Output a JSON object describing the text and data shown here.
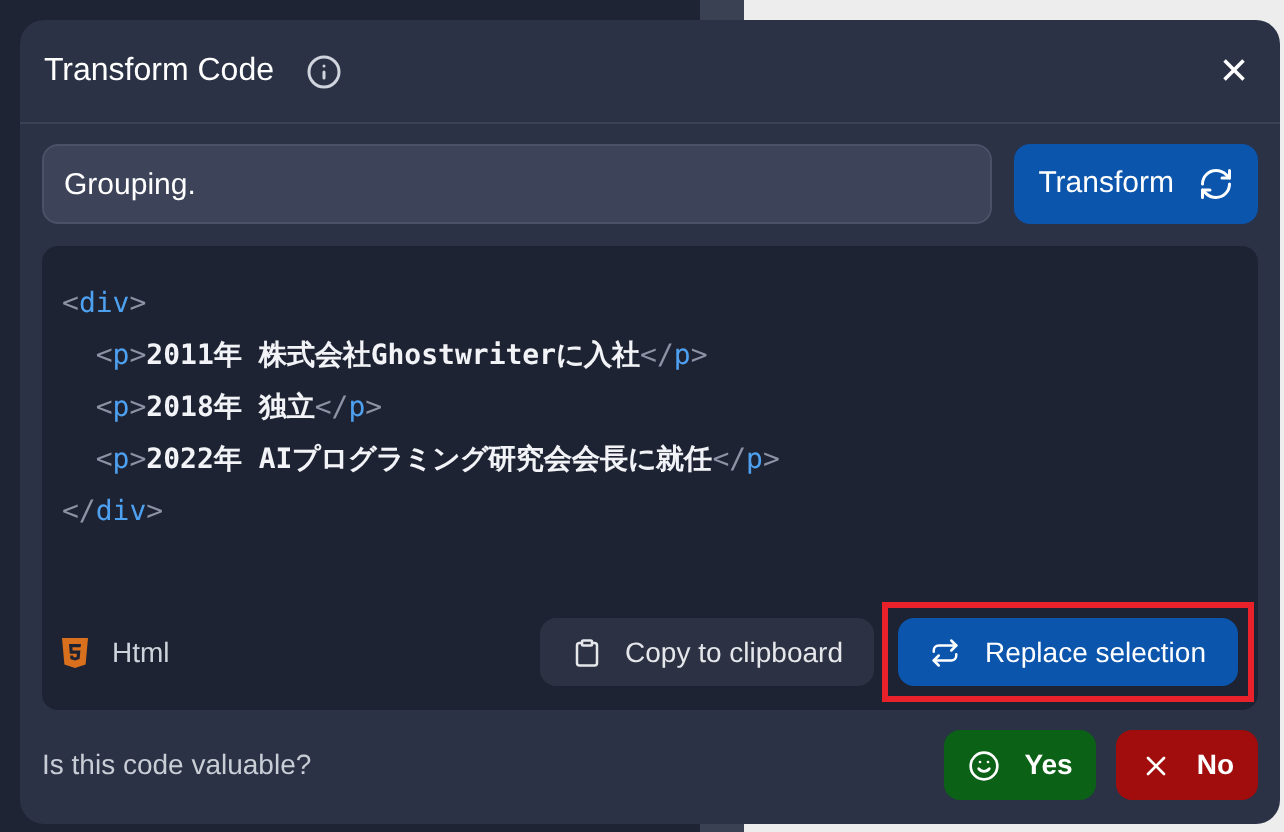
{
  "dialog": {
    "title": "Transform Code",
    "close_label": "×"
  },
  "instruction": {
    "value": "Grouping."
  },
  "transform_button": {
    "label": "Transform"
  },
  "code": {
    "lines": [
      [
        {
          "kind": "punct",
          "text": "<"
        },
        {
          "kind": "tag",
          "text": "div"
        },
        {
          "kind": "punct",
          "text": ">"
        }
      ],
      [
        {
          "kind": "punct",
          "text": "  <"
        },
        {
          "kind": "tag",
          "text": "p"
        },
        {
          "kind": "punct",
          "text": ">"
        },
        {
          "kind": "text",
          "text": "2011年 株式会社Ghostwriterに入社"
        },
        {
          "kind": "punct",
          "text": "</"
        },
        {
          "kind": "tag",
          "text": "p"
        },
        {
          "kind": "punct",
          "text": ">"
        }
      ],
      [
        {
          "kind": "punct",
          "text": "  <"
        },
        {
          "kind": "tag",
          "text": "p"
        },
        {
          "kind": "punct",
          "text": ">"
        },
        {
          "kind": "text",
          "text": "2018年 独立"
        },
        {
          "kind": "punct",
          "text": "</"
        },
        {
          "kind": "tag",
          "text": "p"
        },
        {
          "kind": "punct",
          "text": ">"
        }
      ],
      [
        {
          "kind": "punct",
          "text": "  <"
        },
        {
          "kind": "tag",
          "text": "p"
        },
        {
          "kind": "punct",
          "text": ">"
        },
        {
          "kind": "text",
          "text": "2022年 AIプログラミング研究会会長に就任"
        },
        {
          "kind": "punct",
          "text": "</"
        },
        {
          "kind": "tag",
          "text": "p"
        },
        {
          "kind": "punct",
          "text": ">"
        }
      ],
      [
        {
          "kind": "punct",
          "text": "</"
        },
        {
          "kind": "tag",
          "text": "div"
        },
        {
          "kind": "punct",
          "text": ">"
        }
      ]
    ],
    "language": "Html"
  },
  "actions": [
    {
      "kind": "copy",
      "label": "Copy to clipboard",
      "highlighted": false
    },
    {
      "kind": "replace",
      "label": "Replace selection",
      "highlighted": true
    }
  ],
  "feedback": {
    "question": "Is this code valuable?",
    "buttons": [
      {
        "kind": "yes",
        "label": "Yes"
      },
      {
        "kind": "no",
        "label": "No"
      }
    ]
  }
}
